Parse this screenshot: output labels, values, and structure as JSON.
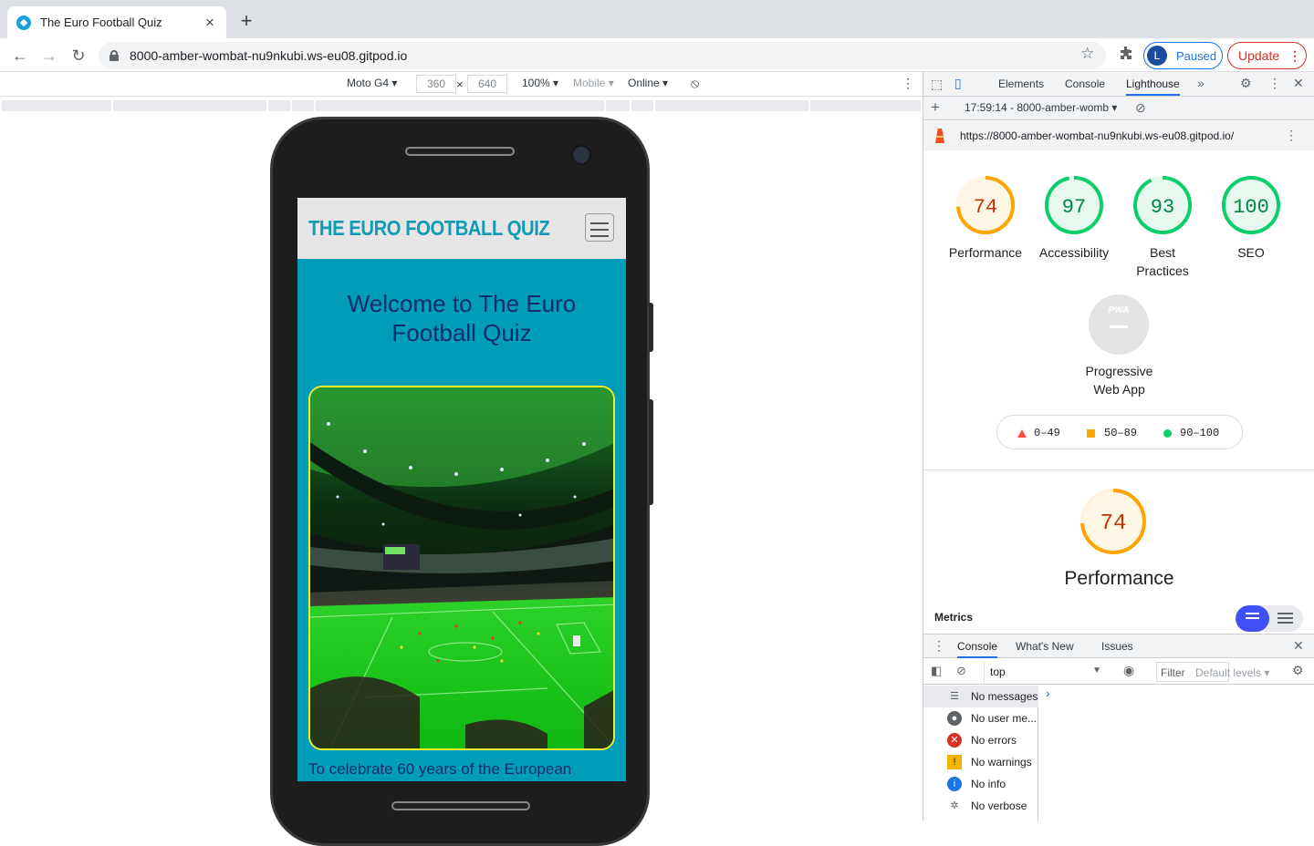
{
  "browser": {
    "tab_title": "The Euro Football Quiz",
    "url": "8000-amber-wombat-nu9nkubi.ws-eu08.gitpod.io",
    "profile_initial": "L",
    "profile_label": "Paused",
    "update_label": "Update"
  },
  "device_toolbar": {
    "device": "Moto G4",
    "width": "360",
    "height": "640",
    "zoom": "100%",
    "mode": "Mobile",
    "network": "Online"
  },
  "site": {
    "brand": "THE EURO FOOTBALL QUIZ",
    "welcome": "Welcome to The Euro Football Quiz",
    "intro": "To celebrate 60 years of the European"
  },
  "devtools": {
    "tabs": [
      "Elements",
      "Console",
      "Lighthouse"
    ],
    "report_time": "17:59:14 - 8000-amber-womb",
    "report_url": "https://8000-amber-wombat-nu9nkubi.ws-eu08.gitpod.io/",
    "scores": [
      {
        "label": "Performance",
        "value": 74,
        "color": "#ffa400"
      },
      {
        "label": "Accessibility",
        "value": 97,
        "color": "#0cce6b"
      },
      {
        "label": "Best Practices",
        "value": 93,
        "color": "#0cce6b"
      },
      {
        "label": "SEO",
        "value": 100,
        "color": "#0cce6b"
      }
    ],
    "pwa_label": "Progressive Web App",
    "legend": [
      "0–49",
      "50–89",
      "90–100"
    ],
    "big_score": 74,
    "big_label": "Performance",
    "metrics_label": "Metrics"
  },
  "drawer": {
    "tabs": [
      "Console",
      "What's New",
      "Issues"
    ],
    "context": "top",
    "filter_placeholder": "Filter",
    "levels": "Default levels",
    "sidebar": [
      "No messages",
      "No user me...",
      "No errors",
      "No warnings",
      "No info",
      "No verbose"
    ]
  },
  "colors": {
    "accent": "#1a73e8",
    "site_bg": "#009dba",
    "site_heading": "#0e2e6b",
    "pass": "#0cce6b",
    "average": "#ffa400",
    "fail": "#ff4e42"
  }
}
